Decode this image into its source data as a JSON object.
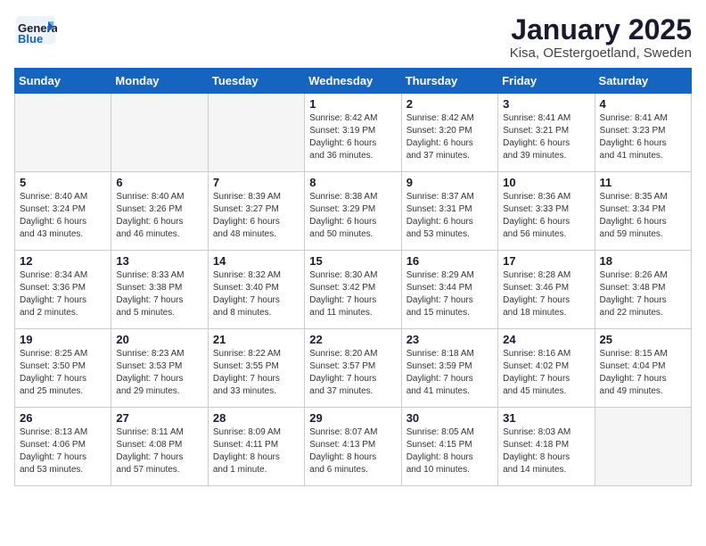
{
  "header": {
    "logo_general": "General",
    "logo_blue": "Blue",
    "month_title": "January 2025",
    "subtitle": "Kisa, OEstergoetland, Sweden"
  },
  "weekdays": [
    "Sunday",
    "Monday",
    "Tuesday",
    "Wednesday",
    "Thursday",
    "Friday",
    "Saturday"
  ],
  "weeks": [
    [
      {
        "day": "",
        "info": ""
      },
      {
        "day": "",
        "info": ""
      },
      {
        "day": "",
        "info": ""
      },
      {
        "day": "1",
        "info": "Sunrise: 8:42 AM\nSunset: 3:19 PM\nDaylight: 6 hours\nand 36 minutes."
      },
      {
        "day": "2",
        "info": "Sunrise: 8:42 AM\nSunset: 3:20 PM\nDaylight: 6 hours\nand 37 minutes."
      },
      {
        "day": "3",
        "info": "Sunrise: 8:41 AM\nSunset: 3:21 PM\nDaylight: 6 hours\nand 39 minutes."
      },
      {
        "day": "4",
        "info": "Sunrise: 8:41 AM\nSunset: 3:23 PM\nDaylight: 6 hours\nand 41 minutes."
      }
    ],
    [
      {
        "day": "5",
        "info": "Sunrise: 8:40 AM\nSunset: 3:24 PM\nDaylight: 6 hours\nand 43 minutes."
      },
      {
        "day": "6",
        "info": "Sunrise: 8:40 AM\nSunset: 3:26 PM\nDaylight: 6 hours\nand 46 minutes."
      },
      {
        "day": "7",
        "info": "Sunrise: 8:39 AM\nSunset: 3:27 PM\nDaylight: 6 hours\nand 48 minutes."
      },
      {
        "day": "8",
        "info": "Sunrise: 8:38 AM\nSunset: 3:29 PM\nDaylight: 6 hours\nand 50 minutes."
      },
      {
        "day": "9",
        "info": "Sunrise: 8:37 AM\nSunset: 3:31 PM\nDaylight: 6 hours\nand 53 minutes."
      },
      {
        "day": "10",
        "info": "Sunrise: 8:36 AM\nSunset: 3:33 PM\nDaylight: 6 hours\nand 56 minutes."
      },
      {
        "day": "11",
        "info": "Sunrise: 8:35 AM\nSunset: 3:34 PM\nDaylight: 6 hours\nand 59 minutes."
      }
    ],
    [
      {
        "day": "12",
        "info": "Sunrise: 8:34 AM\nSunset: 3:36 PM\nDaylight: 7 hours\nand 2 minutes."
      },
      {
        "day": "13",
        "info": "Sunrise: 8:33 AM\nSunset: 3:38 PM\nDaylight: 7 hours\nand 5 minutes."
      },
      {
        "day": "14",
        "info": "Sunrise: 8:32 AM\nSunset: 3:40 PM\nDaylight: 7 hours\nand 8 minutes."
      },
      {
        "day": "15",
        "info": "Sunrise: 8:30 AM\nSunset: 3:42 PM\nDaylight: 7 hours\nand 11 minutes."
      },
      {
        "day": "16",
        "info": "Sunrise: 8:29 AM\nSunset: 3:44 PM\nDaylight: 7 hours\nand 15 minutes."
      },
      {
        "day": "17",
        "info": "Sunrise: 8:28 AM\nSunset: 3:46 PM\nDaylight: 7 hours\nand 18 minutes."
      },
      {
        "day": "18",
        "info": "Sunrise: 8:26 AM\nSunset: 3:48 PM\nDaylight: 7 hours\nand 22 minutes."
      }
    ],
    [
      {
        "day": "19",
        "info": "Sunrise: 8:25 AM\nSunset: 3:50 PM\nDaylight: 7 hours\nand 25 minutes."
      },
      {
        "day": "20",
        "info": "Sunrise: 8:23 AM\nSunset: 3:53 PM\nDaylight: 7 hours\nand 29 minutes."
      },
      {
        "day": "21",
        "info": "Sunrise: 8:22 AM\nSunset: 3:55 PM\nDaylight: 7 hours\nand 33 minutes."
      },
      {
        "day": "22",
        "info": "Sunrise: 8:20 AM\nSunset: 3:57 PM\nDaylight: 7 hours\nand 37 minutes."
      },
      {
        "day": "23",
        "info": "Sunrise: 8:18 AM\nSunset: 3:59 PM\nDaylight: 7 hours\nand 41 minutes."
      },
      {
        "day": "24",
        "info": "Sunrise: 8:16 AM\nSunset: 4:02 PM\nDaylight: 7 hours\nand 45 minutes."
      },
      {
        "day": "25",
        "info": "Sunrise: 8:15 AM\nSunset: 4:04 PM\nDaylight: 7 hours\nand 49 minutes."
      }
    ],
    [
      {
        "day": "26",
        "info": "Sunrise: 8:13 AM\nSunset: 4:06 PM\nDaylight: 7 hours\nand 53 minutes."
      },
      {
        "day": "27",
        "info": "Sunrise: 8:11 AM\nSunset: 4:08 PM\nDaylight: 7 hours\nand 57 minutes."
      },
      {
        "day": "28",
        "info": "Sunrise: 8:09 AM\nSunset: 4:11 PM\nDaylight: 8 hours\nand 1 minute."
      },
      {
        "day": "29",
        "info": "Sunrise: 8:07 AM\nSunset: 4:13 PM\nDaylight: 8 hours\nand 6 minutes."
      },
      {
        "day": "30",
        "info": "Sunrise: 8:05 AM\nSunset: 4:15 PM\nDaylight: 8 hours\nand 10 minutes."
      },
      {
        "day": "31",
        "info": "Sunrise: 8:03 AM\nSunset: 4:18 PM\nDaylight: 8 hours\nand 14 minutes."
      },
      {
        "day": "",
        "info": ""
      }
    ]
  ]
}
